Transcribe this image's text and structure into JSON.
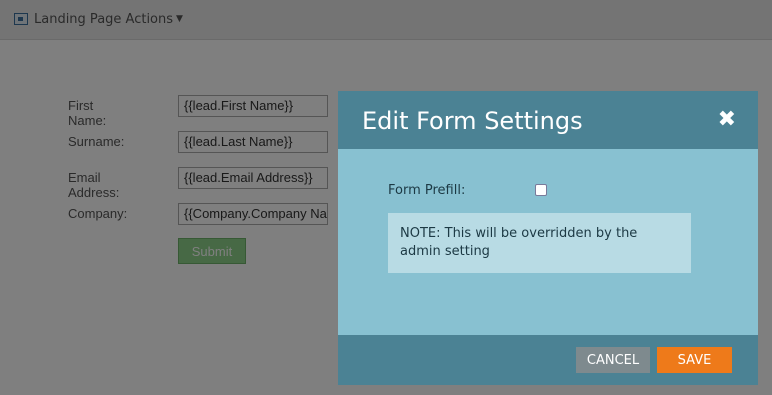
{
  "toolbar": {
    "actions_label": "Landing Page Actions",
    "actions_icon": "landing-page-icon",
    "caret_icon": "caret-down-icon"
  },
  "form": {
    "fields": [
      {
        "label": "First Name:",
        "value": "{{lead.First Name}}"
      },
      {
        "label": "Surname:",
        "value": "{{lead.Last Name}}"
      },
      {
        "label": "Email Address:",
        "value": "{{lead.Email Address}}"
      },
      {
        "label": "Company:",
        "value": "{{Company.Company Na"
      }
    ],
    "submit_label": "Submit"
  },
  "dialog": {
    "title": "Edit Form Settings",
    "close_icon": "close-icon",
    "prefill_label": "Form Prefill:",
    "prefill_checked": false,
    "note": "NOTE:  This will be overridden by the admin setting",
    "cancel_label": "CANCEL",
    "save_label": "SAVE"
  },
  "colors": {
    "header": "#4b8294",
    "body": "#88c1d1",
    "note": "#b8dbe4",
    "save": "#ee7a1a",
    "cancel": "#7e8a8e",
    "submit": "#8fd38b"
  }
}
